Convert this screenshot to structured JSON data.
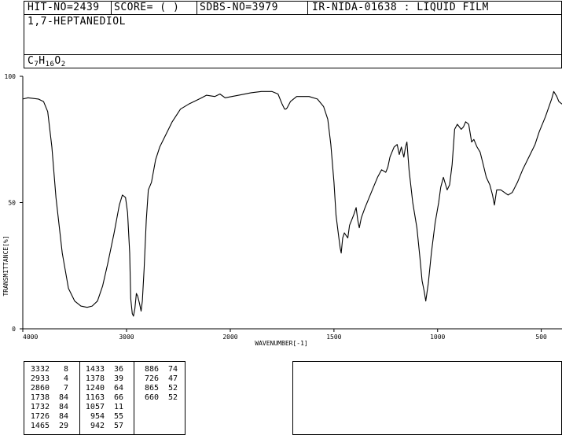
{
  "header": {
    "hit_no": "HIT-NO=2439",
    "score": "SCORE=  (  )",
    "sdbs_no": "SDBS-NO=3979",
    "ir_code": "IR-NIDA-01638 : LIQUID FILM"
  },
  "compound": {
    "name": "1,7-HEPTANEDIOL",
    "formula_parts": [
      {
        "text": "C",
        "sub": false
      },
      {
        "text": "7",
        "sub": true
      },
      {
        "text": "H",
        "sub": false
      },
      {
        "text": "16",
        "sub": true
      },
      {
        "text": "O",
        "sub": false
      },
      {
        "text": "2",
        "sub": true
      }
    ]
  },
  "chart_data": {
    "type": "line",
    "xlabel": "WAVENUMBER[-1]",
    "ylabel": "TRANSMITTANCE[%]",
    "xlim": [
      4000,
      400
    ],
    "ylim": [
      0,
      100
    ],
    "x_ticks": [
      4000,
      3000,
      2000,
      1500,
      1000,
      500
    ],
    "x_tick_labels": [
      "4000",
      "3000",
      "2000",
      "1500",
      "1000",
      "500"
    ],
    "y_ticks": [
      0,
      50,
      100
    ],
    "y_tick_labels": [
      "0",
      "50",
      "100"
    ],
    "grid": false,
    "series": [
      {
        "values": [
          [
            4000,
            91
          ],
          [
            3950,
            91.5
          ],
          [
            3850,
            91
          ],
          [
            3800,
            90
          ],
          [
            3760,
            86
          ],
          [
            3720,
            72
          ],
          [
            3680,
            52
          ],
          [
            3620,
            30
          ],
          [
            3560,
            16
          ],
          [
            3500,
            11
          ],
          [
            3440,
            9
          ],
          [
            3380,
            8.5
          ],
          [
            3332,
            9
          ],
          [
            3280,
            11
          ],
          [
            3230,
            17
          ],
          [
            3180,
            26
          ],
          [
            3120,
            38
          ],
          [
            3070,
            49
          ],
          [
            3040,
            53
          ],
          [
            3010,
            52
          ],
          [
            2990,
            46
          ],
          [
            2970,
            30
          ],
          [
            2960,
            12
          ],
          [
            2945,
            6
          ],
          [
            2933,
            5
          ],
          [
            2920,
            8
          ],
          [
            2905,
            14
          ],
          [
            2893,
            13
          ],
          [
            2875,
            10
          ],
          [
            2860,
            7
          ],
          [
            2848,
            11
          ],
          [
            2830,
            24
          ],
          [
            2810,
            43
          ],
          [
            2790,
            55
          ],
          [
            2760,
            58
          ],
          [
            2720,
            67
          ],
          [
            2680,
            72
          ],
          [
            2620,
            77
          ],
          [
            2560,
            82
          ],
          [
            2480,
            87
          ],
          [
            2400,
            89
          ],
          [
            2300,
            91
          ],
          [
            2230,
            92.5
          ],
          [
            2150,
            92
          ],
          [
            2100,
            93
          ],
          [
            2050,
            91.5
          ],
          [
            1960,
            92.5
          ],
          [
            1900,
            93.5
          ],
          [
            1850,
            94
          ],
          [
            1800,
            94
          ],
          [
            1770,
            93
          ],
          [
            1750,
            89
          ],
          [
            1738,
            87
          ],
          [
            1732,
            87
          ],
          [
            1726,
            87.5
          ],
          [
            1710,
            90
          ],
          [
            1680,
            92
          ],
          [
            1620,
            92
          ],
          [
            1580,
            91
          ],
          [
            1550,
            88
          ],
          [
            1530,
            83
          ],
          [
            1515,
            73
          ],
          [
            1500,
            58
          ],
          [
            1490,
            45
          ],
          [
            1478,
            37
          ],
          [
            1470,
            32
          ],
          [
            1465,
            30
          ],
          [
            1458,
            36
          ],
          [
            1450,
            38
          ],
          [
            1442,
            37
          ],
          [
            1433,
            36
          ],
          [
            1425,
            41
          ],
          [
            1405,
            45
          ],
          [
            1393,
            48
          ],
          [
            1385,
            43
          ],
          [
            1378,
            40
          ],
          [
            1368,
            44
          ],
          [
            1350,
            48
          ],
          [
            1330,
            52
          ],
          [
            1310,
            56
          ],
          [
            1290,
            60
          ],
          [
            1270,
            63
          ],
          [
            1250,
            62
          ],
          [
            1240,
            64
          ],
          [
            1230,
            68
          ],
          [
            1220,
            70
          ],
          [
            1210,
            72
          ],
          [
            1195,
            73
          ],
          [
            1185,
            69
          ],
          [
            1175,
            72
          ],
          [
            1163,
            68
          ],
          [
            1155,
            72
          ],
          [
            1148,
            74
          ],
          [
            1138,
            63
          ],
          [
            1120,
            50
          ],
          [
            1100,
            40
          ],
          [
            1085,
            28
          ],
          [
            1075,
            19
          ],
          [
            1065,
            15
          ],
          [
            1057,
            11
          ],
          [
            1045,
            18
          ],
          [
            1030,
            30
          ],
          [
            1012,
            42
          ],
          [
            995,
            50
          ],
          [
            985,
            56
          ],
          [
            972,
            60
          ],
          [
            954,
            55
          ],
          [
            942,
            57
          ],
          [
            930,
            65
          ],
          [
            918,
            79
          ],
          [
            905,
            81
          ],
          [
            886,
            79
          ],
          [
            875,
            80
          ],
          [
            865,
            82
          ],
          [
            850,
            81
          ],
          [
            836,
            74
          ],
          [
            825,
            75
          ],
          [
            810,
            72
          ],
          [
            795,
            70
          ],
          [
            780,
            65
          ],
          [
            765,
            60
          ],
          [
            748,
            57
          ],
          [
            735,
            53
          ],
          [
            726,
            49
          ],
          [
            715,
            55
          ],
          [
            695,
            55
          ],
          [
            660,
            53
          ],
          [
            640,
            54
          ],
          [
            615,
            58
          ],
          [
            590,
            63
          ],
          [
            560,
            68
          ],
          [
            530,
            73
          ],
          [
            510,
            78
          ],
          [
            480,
            84
          ],
          [
            450,
            91
          ],
          [
            440,
            94
          ],
          [
            425,
            92
          ],
          [
            415,
            90
          ],
          [
            400,
            89
          ]
        ]
      }
    ]
  },
  "peak_table": {
    "columns": [
      [
        [
          "3332",
          "8"
        ],
        [
          "2933",
          "4"
        ],
        [
          "2860",
          "7"
        ],
        [
          "1738",
          "84"
        ],
        [
          "1732",
          "84"
        ],
        [
          "1726",
          "84"
        ],
        [
          "1465",
          "29"
        ]
      ],
      [
        [
          "1433",
          "36"
        ],
        [
          "1378",
          "39"
        ],
        [
          "1240",
          "64"
        ],
        [
          "1163",
          "66"
        ],
        [
          "1057",
          "11"
        ],
        [
          "954",
          "55"
        ],
        [
          "942",
          "57"
        ]
      ],
      [
        [
          "886",
          "74"
        ],
        [
          "726",
          "47"
        ],
        [
          "865",
          "52"
        ],
        [
          "660",
          "52"
        ]
      ]
    ]
  }
}
